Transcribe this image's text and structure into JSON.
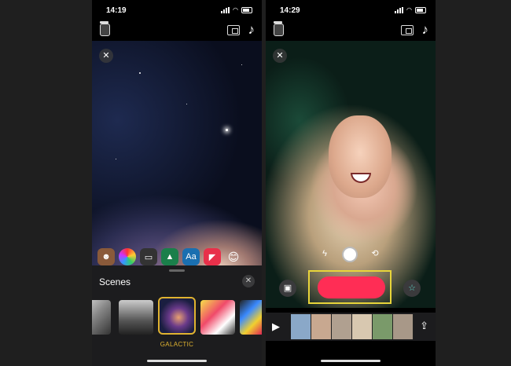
{
  "left": {
    "status": {
      "time": "14:19"
    },
    "top_icons": {
      "storage": "jar-icon",
      "aspect": "aspect-ratio-icon",
      "music": "music-note-icon"
    },
    "close_icon": "✕",
    "music_glyph": "♪",
    "effects": {
      "memoji": "memoji-icon",
      "filters": "filters-icon",
      "text_bubble": "speech-bubble-icon",
      "picture": "picture-icon",
      "text_label": "Aa",
      "sticker": "sticker-icon",
      "emoji_glyph": "😊"
    },
    "drawer": {
      "title": "Scenes",
      "close": "✕",
      "selected_scene": "GALACTIC"
    }
  },
  "right": {
    "status": {
      "time": "14:29"
    },
    "close_icon": "✕",
    "music_glyph": "♪",
    "controls": {
      "flash": "ϟ",
      "flip": "⟲"
    },
    "star_glyph": "☆",
    "play_glyph": "▶",
    "share_glyph": "⇪"
  },
  "colors": {
    "record": "#ff2d55",
    "selected": "#e0b330",
    "highlight": "#e8d53a"
  }
}
